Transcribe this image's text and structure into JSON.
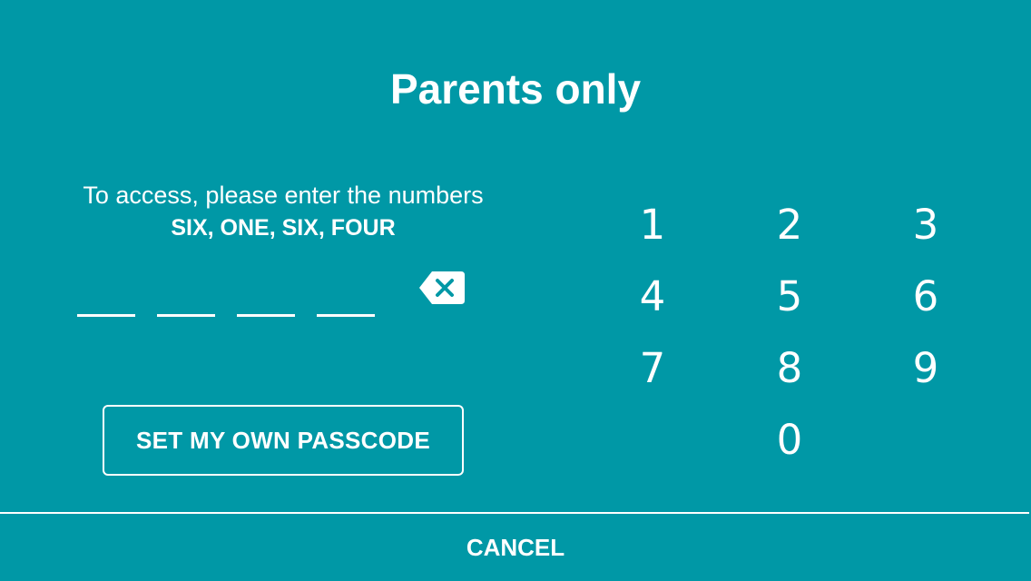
{
  "dialog": {
    "title": "Parents only",
    "instruction": "To access, please enter the numbers",
    "code_words": "SIX, ONE, SIX, FOUR",
    "entered_digits": [
      "",
      "",
      "",
      ""
    ],
    "backspace_icon": "backspace-icon",
    "set_passcode_label": "SET MY OWN PASSCODE",
    "cancel_label": "CANCEL"
  },
  "keypad": {
    "keys": [
      "1",
      "2",
      "3",
      "4",
      "5",
      "6",
      "7",
      "8",
      "9",
      "0"
    ]
  },
  "colors": {
    "background": "#0098a6",
    "foreground": "#ffffff"
  }
}
